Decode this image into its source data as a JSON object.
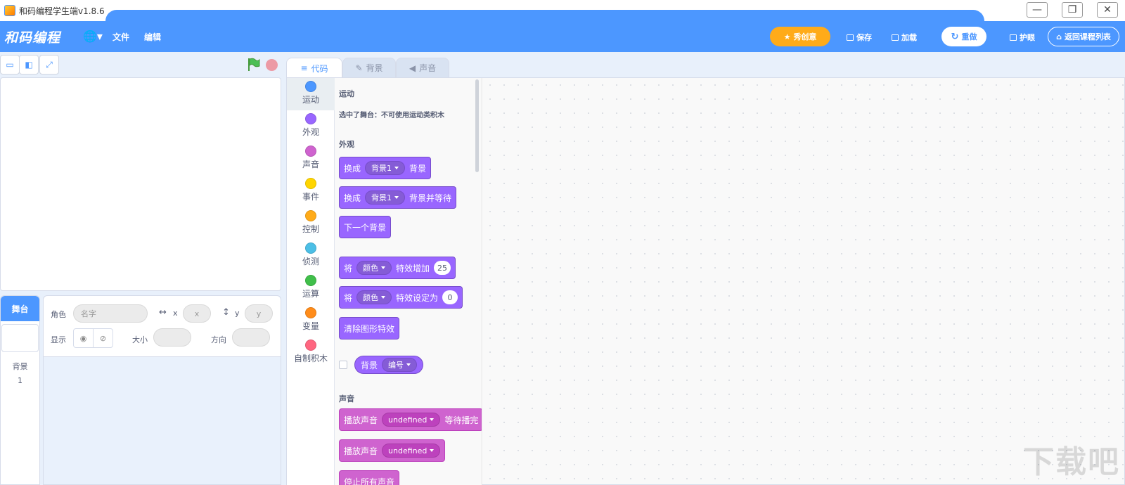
{
  "window": {
    "title": "和码编程学生端v1.8.6",
    "minimize": "—",
    "restore": "❐",
    "close": "✕"
  },
  "menubar": {
    "logo": "和码编程",
    "globe": "🌐▾",
    "file": "文件",
    "edit": "编辑",
    "show_creative": "秀创意",
    "save": "保存",
    "load": "加载",
    "restart": "重做",
    "eye_care": "护眼",
    "back_to_courses": "返回课程列表"
  },
  "stage_controls": {
    "small_stage": "▭",
    "large_stage": "◧",
    "fullscreen": "⤢"
  },
  "tabs": {
    "code": "代码",
    "backdrops": "背景",
    "sounds": "声音"
  },
  "categories": [
    {
      "label": "运动",
      "color": "#4c97ff"
    },
    {
      "label": "外观",
      "color": "#9966ff"
    },
    {
      "label": "声音",
      "color": "#cf63cf"
    },
    {
      "label": "事件",
      "color": "#ffd500"
    },
    {
      "label": "控制",
      "color": "#ffab19"
    },
    {
      "label": "侦测",
      "color": "#4cbfe6"
    },
    {
      "label": "运算",
      "color": "#40bf4a"
    },
    {
      "label": "变量",
      "color": "#ff8c1a"
    },
    {
      "label": "自制积木",
      "color": "#ff6680"
    }
  ],
  "palette": {
    "motion_title": "运动",
    "motion_note": "选中了舞台：不可使用运动类积木",
    "looks_title": "外观",
    "b1": {
      "a": "换成",
      "drop": "背景1",
      "b": "背景"
    },
    "b2": {
      "a": "换成",
      "drop": "背景1",
      "b": "背景并等待"
    },
    "b3": {
      "a": "下一个背景"
    },
    "b4": {
      "a": "将",
      "drop": "颜色",
      "b": "特效增加",
      "num": "25"
    },
    "b5": {
      "a": "将",
      "drop": "颜色",
      "b": "特效设定为",
      "num": "0"
    },
    "b6": {
      "a": "清除图形特效"
    },
    "r1": {
      "a": "背景",
      "drop": "编号"
    },
    "sound_title": "声音",
    "s1": {
      "a": "播放声音",
      "drop": "undefined",
      "b": "等待播完"
    },
    "s2": {
      "a": "播放声音",
      "drop": "undefined"
    },
    "s3": {
      "a": "停止所有声音"
    }
  },
  "sprite_info": {
    "sprite_label": "角色",
    "name_placeholder": "名字",
    "x_label": "x",
    "x_placeholder": "x",
    "y_label": "y",
    "y_placeholder": "y",
    "show_label": "显示",
    "size_label": "大小",
    "direction_label": "方向"
  },
  "stage_panel": {
    "header": "舞台",
    "backdrops_label": "背景",
    "backdrops_count": "1"
  },
  "watermark": "下载吧"
}
